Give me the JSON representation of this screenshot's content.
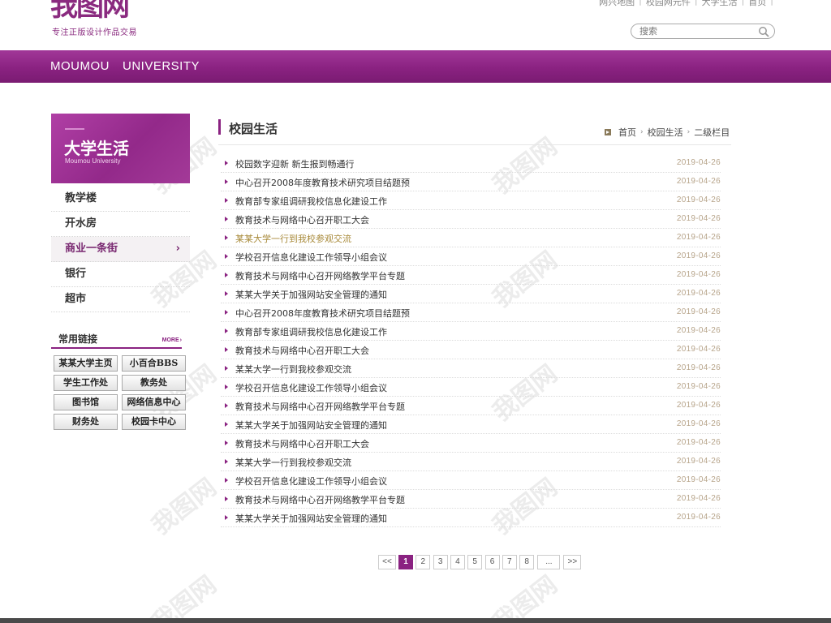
{
  "header": {
    "logo_text": "我图网",
    "slogan": "专注正版设计作品交易",
    "top_links": [
      "网兴地图",
      "校园网元件",
      "大学生活",
      "首页"
    ],
    "search_placeholder": "搜索"
  },
  "navbar": {
    "university_word1": "MOUMOU",
    "university_word2": "UNIVERSITY"
  },
  "sidebar": {
    "banner_title": "大学生活",
    "banner_sub": "Moumou University",
    "items": [
      {
        "label": "教学楼"
      },
      {
        "label": "开水房"
      },
      {
        "label": "商业一条街",
        "active": true,
        "arrow": "›"
      },
      {
        "label": "银行"
      },
      {
        "label": "超市"
      }
    ],
    "links_title": "常用链接",
    "links_more": "MORE",
    "links": [
      "某某大学主页",
      "小百合BBS",
      "学生工作处",
      "教务处",
      "图书馆",
      "网络信息中心",
      "财务处",
      "校园卡中心"
    ]
  },
  "main": {
    "title": "校园生活",
    "breadcrumb": [
      "首页",
      "校园生活",
      "二级栏目"
    ],
    "news": [
      {
        "title": "校园数字迎新 新生报到畅通行",
        "date": "2019-04-26"
      },
      {
        "title": "中心召开2008年度教育技术研究项目结题预",
        "date": "2019-04-26"
      },
      {
        "title": "教育部专家组调研我校信息化建设工作",
        "date": "2019-04-26"
      },
      {
        "title": "教育技术与网络中心召开职工大会",
        "date": "2019-04-26"
      },
      {
        "title": "某某大学一行到我校参观交流",
        "date": "2019-04-26",
        "highlight": true
      },
      {
        "title": "学校召开信息化建设工作领导小组会议",
        "date": "2019-04-26"
      },
      {
        "title": "教育技术与网络中心召开网络教学平台专题",
        "date": "2019-04-26"
      },
      {
        "title": "某某大学关于加强网站安全管理的通知",
        "date": "2019-04-26"
      },
      {
        "title": "中心召开2008年度教育技术研究项目结题预",
        "date": "2019-04-26"
      },
      {
        "title": "教育部专家组调研我校信息化建设工作",
        "date": "2019-04-26"
      },
      {
        "title": "教育技术与网络中心召开职工大会",
        "date": "2019-04-26"
      },
      {
        "title": "某某大学一行到我校参观交流",
        "date": "2019-04-26"
      },
      {
        "title": "学校召开信息化建设工作领导小组会议",
        "date": "2019-04-26"
      },
      {
        "title": "教育技术与网络中心召开网络教学平台专题",
        "date": "2019-04-26"
      },
      {
        "title": "某某大学关于加强网站安全管理的通知",
        "date": "2019-04-26"
      },
      {
        "title": "教育技术与网络中心召开职工大会",
        "date": "2019-04-26"
      },
      {
        "title": "某某大学一行到我校参观交流",
        "date": "2019-04-26"
      },
      {
        "title": "学校召开信息化建设工作领导小组会议",
        "date": "2019-04-26"
      },
      {
        "title": "教育技术与网络中心召开网络教学平台专题",
        "date": "2019-04-26"
      },
      {
        "title": "某某大学关于加强网站安全管理的通知",
        "date": "2019-04-26"
      }
    ],
    "pager": {
      "prev": "<<",
      "pages": [
        "1",
        "2",
        "3",
        "4",
        "5",
        "6",
        "7",
        "8"
      ],
      "current": "1",
      "ellipsis": "...",
      "next": ">>"
    }
  },
  "colors": {
    "brand": "#8a2281",
    "date": "#b7a48a",
    "highlight": "#a88a3a"
  },
  "watermark_text": "我图网"
}
